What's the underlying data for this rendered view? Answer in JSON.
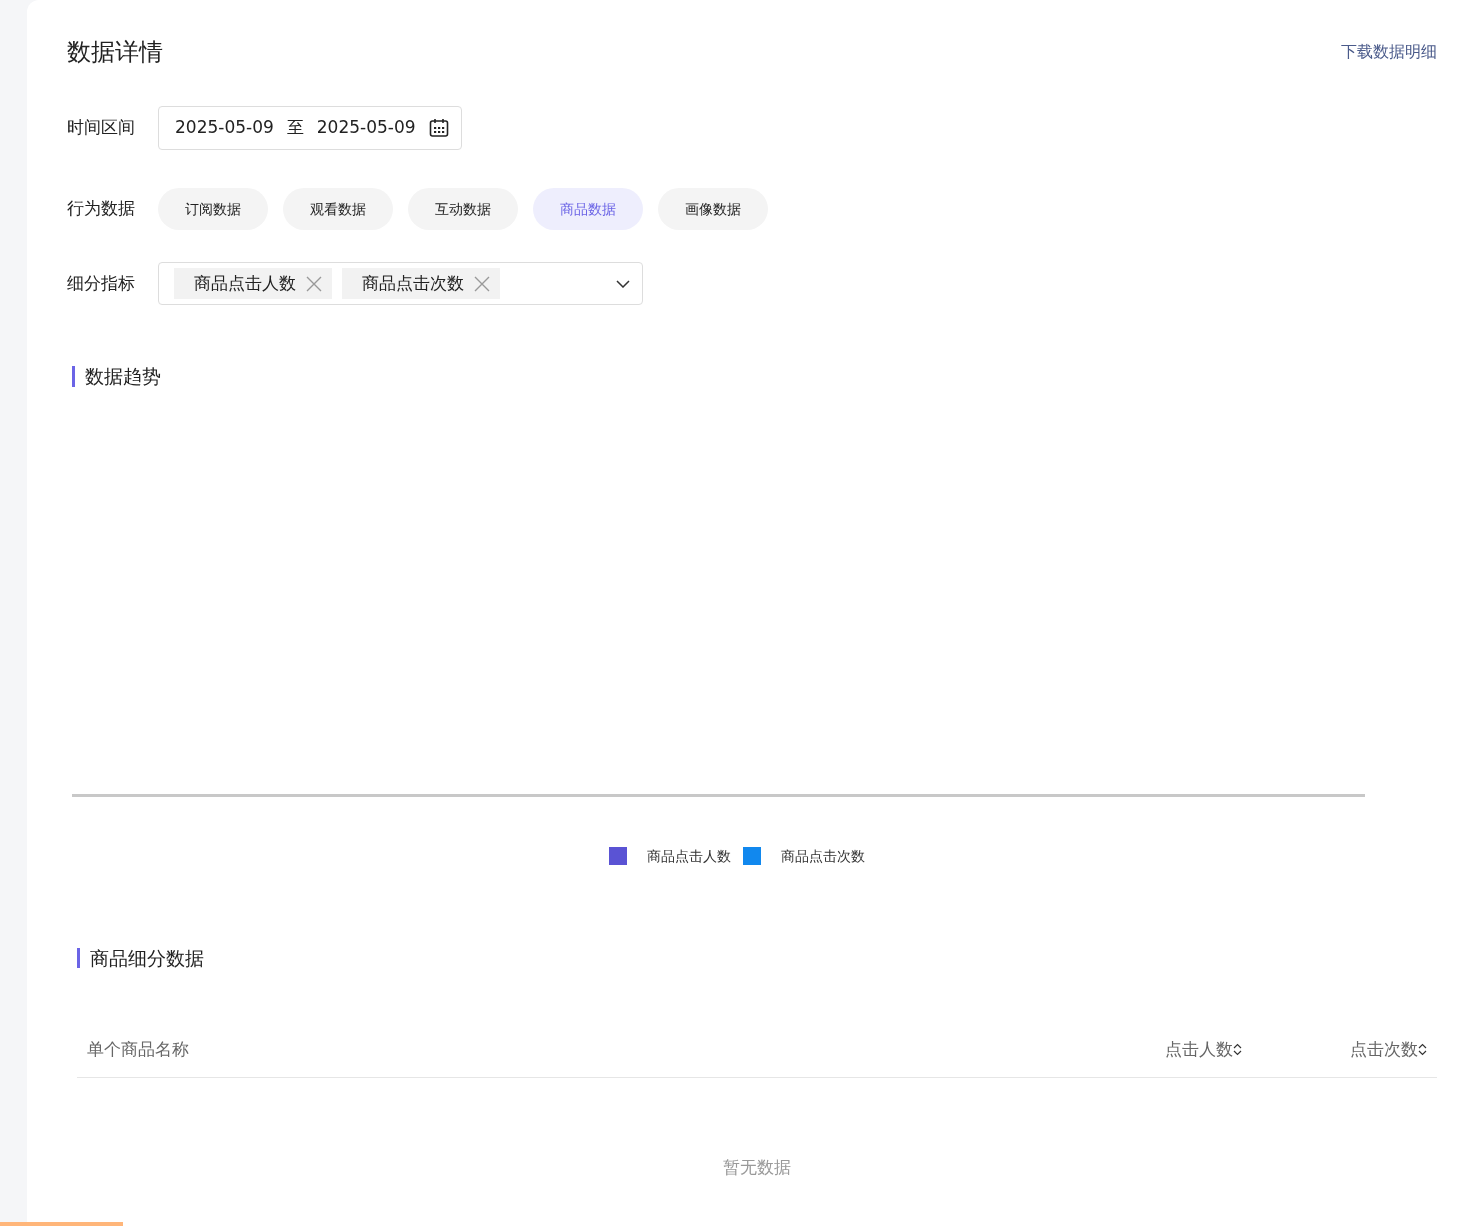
{
  "header": {
    "title": "数据详情",
    "download_link": "下载数据明细"
  },
  "date_range": {
    "label": "时间区间",
    "start": "2025-05-09",
    "separator": "至",
    "end": "2025-05-09"
  },
  "behavior": {
    "label": "行为数据",
    "tabs": [
      {
        "label": "订阅数据",
        "selected": false
      },
      {
        "label": "观看数据",
        "selected": false
      },
      {
        "label": "互动数据",
        "selected": false
      },
      {
        "label": "商品数据",
        "selected": true
      },
      {
        "label": "画像数据",
        "selected": false
      }
    ]
  },
  "metrics": {
    "label": "细分指标",
    "tags": [
      "商品点击人数",
      "商品点击次数"
    ]
  },
  "trend": {
    "title": "数据趋势",
    "legend": [
      {
        "label": "商品点击人数",
        "color": "#5a53d4"
      },
      {
        "label": "商品点击次数",
        "color": "#1188ee"
      }
    ]
  },
  "detail": {
    "title": "商品细分数据",
    "columns": [
      {
        "label": "单个商品名称",
        "sortable": false
      },
      {
        "label": "点击人数",
        "sortable": true
      },
      {
        "label": "点击次数",
        "sortable": true
      }
    ],
    "empty_text": "暂无数据"
  }
}
